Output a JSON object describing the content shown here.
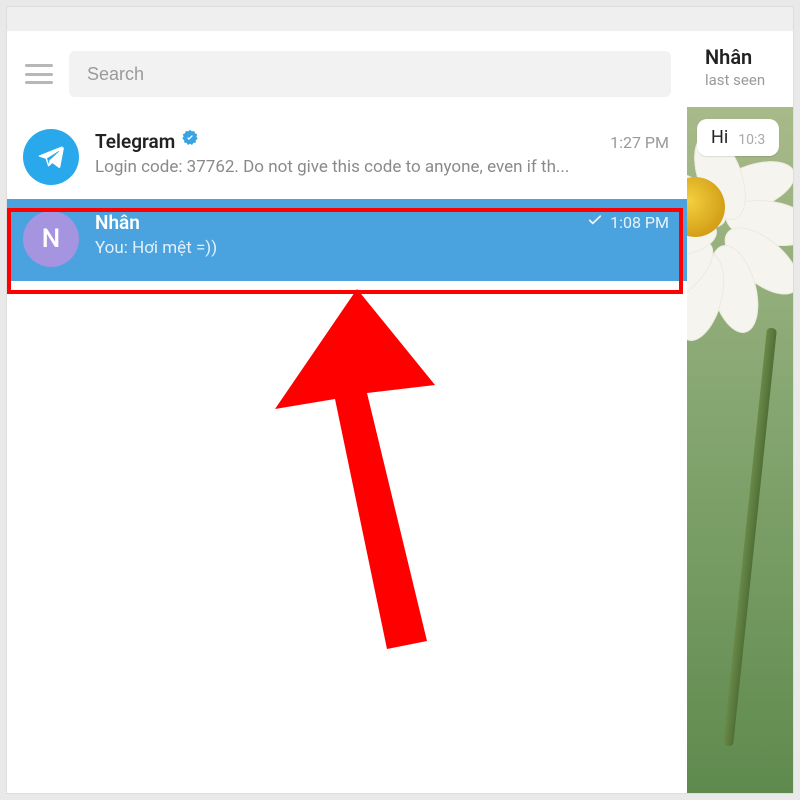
{
  "search": {
    "placeholder": "Search"
  },
  "chats": [
    {
      "id": "telegram",
      "name": "Telegram",
      "verified": true,
      "time": "1:27 PM",
      "preview": "Login code: 37762. Do not give this code to anyone, even if th..."
    },
    {
      "id": "nhan",
      "name": "Nhân",
      "avatar_letter": "N",
      "time": "1:08 PM",
      "preview": "You: Hơi mệt =))",
      "sent_check": true,
      "selected": true
    }
  ],
  "conversation": {
    "title": "Nhân",
    "subtitle": "last seen",
    "messages": [
      {
        "text": "Hi",
        "time": "10:3"
      }
    ]
  },
  "annotation": {
    "highlight_target": "chat item Nhân",
    "arrow": "upward red arrow pointing at selected chat"
  }
}
